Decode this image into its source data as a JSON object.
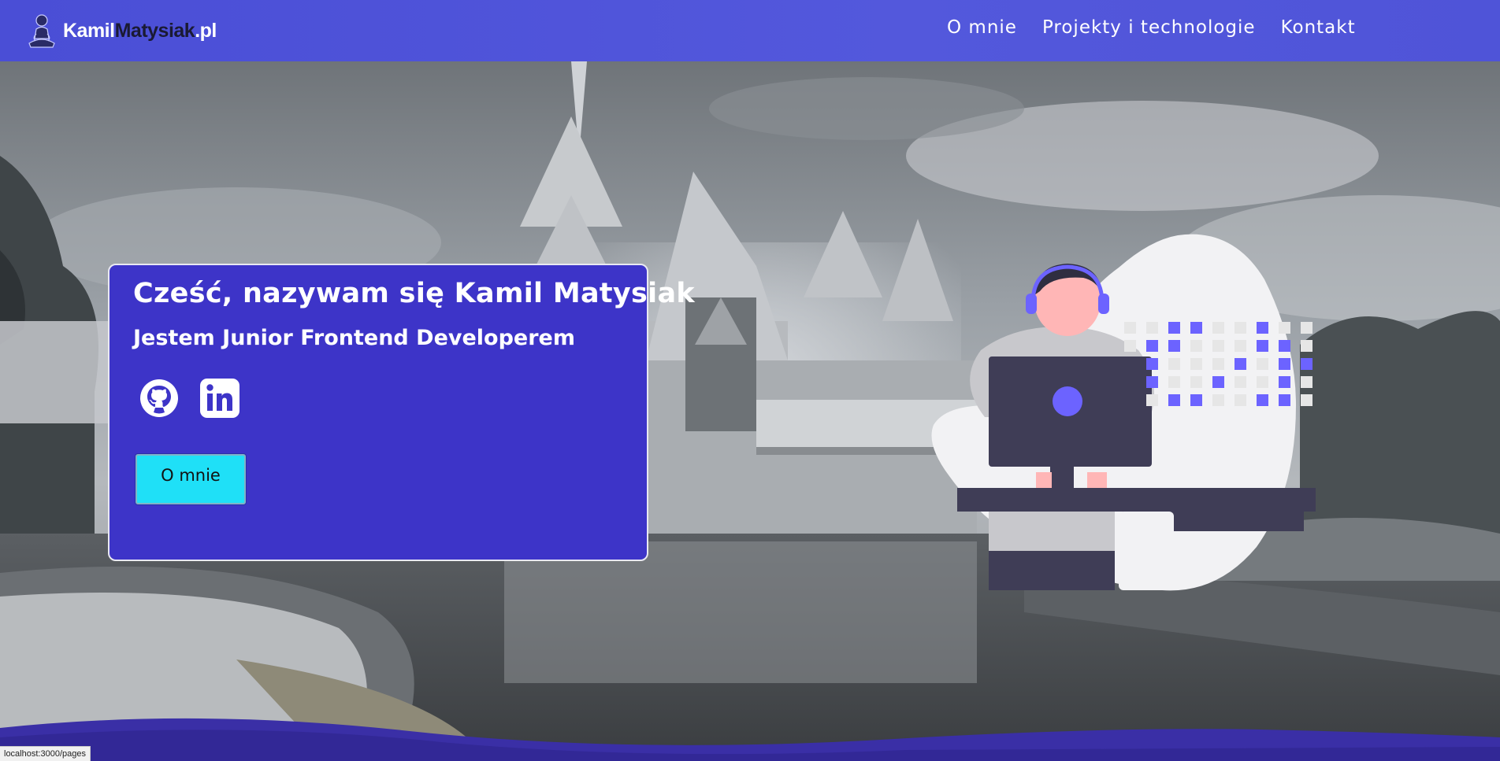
{
  "brand": {
    "part1": "Kamil",
    "part2": "Matysiak",
    "part3": ".pl",
    "logo_icon": "meditating-figure-icon"
  },
  "nav": {
    "items": [
      {
        "label": "O mnie"
      },
      {
        "label": "Projekty i technologie"
      },
      {
        "label": "Kontakt"
      }
    ]
  },
  "intro": {
    "greeting_prefix": "Cześć, nazywam się ",
    "name": "Kamil Matysiak",
    "subtitle": "Jestem Junior Frontend Developerem",
    "social": [
      {
        "icon": "github-icon"
      },
      {
        "icon": "linkedin-icon"
      }
    ],
    "cta_label": "O mnie"
  },
  "status_bar": {
    "url": "localhost:3000/pages"
  },
  "colors": {
    "navbar": "#4f54d8",
    "card": "#3d34c8",
    "cta": "#1fe0f7",
    "accent": "#6c63ff",
    "wave": "#3a2fa6"
  }
}
